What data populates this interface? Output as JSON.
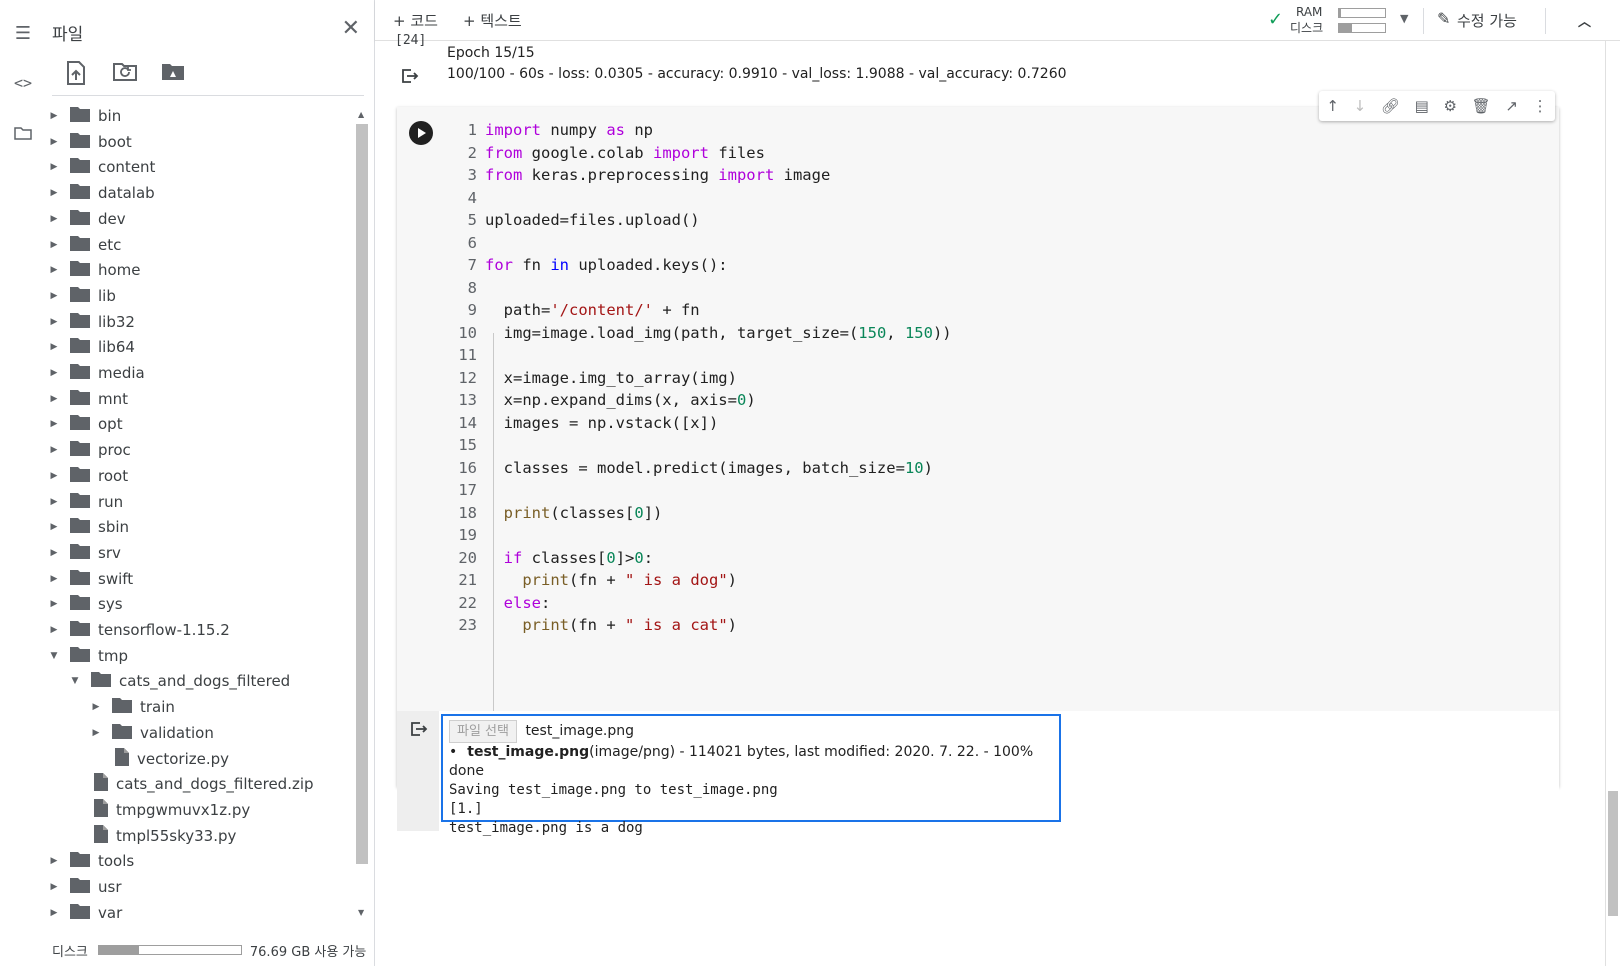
{
  "sidebar": {
    "panel_title": "파일",
    "tree": [
      {
        "label": "bin",
        "type": "folder",
        "depth": 0,
        "expanded": false
      },
      {
        "label": "boot",
        "type": "folder",
        "depth": 0,
        "expanded": false
      },
      {
        "label": "content",
        "type": "folder",
        "depth": 0,
        "expanded": false
      },
      {
        "label": "datalab",
        "type": "folder",
        "depth": 0,
        "expanded": false
      },
      {
        "label": "dev",
        "type": "folder",
        "depth": 0,
        "expanded": false
      },
      {
        "label": "etc",
        "type": "folder",
        "depth": 0,
        "expanded": false
      },
      {
        "label": "home",
        "type": "folder",
        "depth": 0,
        "expanded": false
      },
      {
        "label": "lib",
        "type": "folder",
        "depth": 0,
        "expanded": false
      },
      {
        "label": "lib32",
        "type": "folder",
        "depth": 0,
        "expanded": false
      },
      {
        "label": "lib64",
        "type": "folder",
        "depth": 0,
        "expanded": false
      },
      {
        "label": "media",
        "type": "folder",
        "depth": 0,
        "expanded": false
      },
      {
        "label": "mnt",
        "type": "folder",
        "depth": 0,
        "expanded": false
      },
      {
        "label": "opt",
        "type": "folder",
        "depth": 0,
        "expanded": false
      },
      {
        "label": "proc",
        "type": "folder",
        "depth": 0,
        "expanded": false
      },
      {
        "label": "root",
        "type": "folder",
        "depth": 0,
        "expanded": false
      },
      {
        "label": "run",
        "type": "folder",
        "depth": 0,
        "expanded": false
      },
      {
        "label": "sbin",
        "type": "folder",
        "depth": 0,
        "expanded": false
      },
      {
        "label": "srv",
        "type": "folder",
        "depth": 0,
        "expanded": false
      },
      {
        "label": "swift",
        "type": "folder",
        "depth": 0,
        "expanded": false
      },
      {
        "label": "sys",
        "type": "folder",
        "depth": 0,
        "expanded": false
      },
      {
        "label": "tensorflow-1.15.2",
        "type": "folder",
        "depth": 0,
        "expanded": false
      },
      {
        "label": "tmp",
        "type": "folder",
        "depth": 0,
        "expanded": true
      },
      {
        "label": "cats_and_dogs_filtered",
        "type": "folder",
        "depth": 1,
        "expanded": true
      },
      {
        "label": "train",
        "type": "folder",
        "depth": 2,
        "expanded": false
      },
      {
        "label": "validation",
        "type": "folder",
        "depth": 2,
        "expanded": false
      },
      {
        "label": "vectorize.py",
        "type": "file",
        "depth": 2
      },
      {
        "label": "cats_and_dogs_filtered.zip",
        "type": "file",
        "depth": 1
      },
      {
        "label": "tmpgwmuvx1z.py",
        "type": "file",
        "depth": 1
      },
      {
        "label": "tmpl55sky33.py",
        "type": "file",
        "depth": 1
      },
      {
        "label": "tools",
        "type": "folder",
        "depth": 0,
        "expanded": false
      },
      {
        "label": "usr",
        "type": "folder",
        "depth": 0,
        "expanded": false
      },
      {
        "label": "var",
        "type": "folder",
        "depth": 0,
        "expanded": false
      }
    ],
    "disk_label": "디스크",
    "disk_used_fraction": 0.28,
    "disk_available": "76.69 GB 사용 가능"
  },
  "toolbar": {
    "add_code": "+ 코드",
    "add_text": "+ 텍스트",
    "ram_label": "RAM",
    "disk_label": "디스크",
    "ram_used_fraction": 0.05,
    "disk_used_fraction": 0.28,
    "edit_mode": "수정 가능"
  },
  "notebook": {
    "prev_cell_number": "[24]",
    "epoch_line": "Epoch 15/15",
    "epoch_metrics": "100/100 - 60s - loss: 0.0305 - accuracy: 0.9910 - val_loss: 1.9088 - val_accuracy: 0.7260",
    "output": {
      "file_button": "파일 선택",
      "file_name": "test_image.png",
      "upload_file": "test_image.png",
      "upload_info": "(image/png) - 114021 bytes, last modified: 2020. 7. 22. - 100% done",
      "saving": "Saving test_image.png to test_image.png",
      "classes": "[1.]",
      "result": "test_image.png is a dog"
    }
  },
  "colors": {
    "keyword": "#af00db",
    "builtin": "#0000ff",
    "string": "#a31515",
    "number": "#098658",
    "function": "#795e26",
    "accent": "#1a73e8",
    "check": "#0f9d58"
  }
}
